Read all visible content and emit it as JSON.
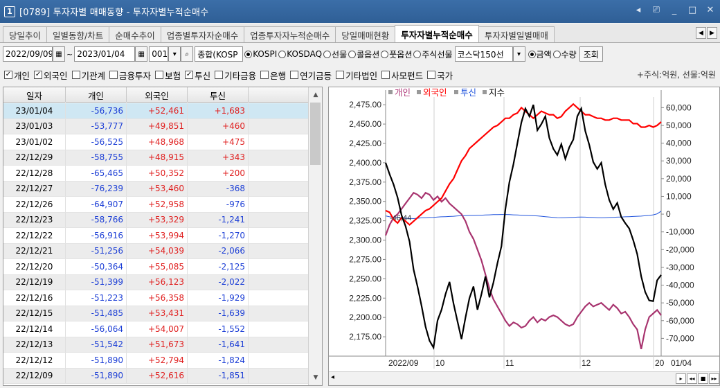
{
  "window": {
    "number": "1",
    "title": "[0789] 투자자별 매매동향 - 투자자별누적순매수",
    "controls": [
      "◂",
      "⎚",
      "_",
      "□",
      "✕"
    ]
  },
  "tabs": [
    {
      "label": "당일추이",
      "active": false
    },
    {
      "label": "일별동향/차트",
      "active": false
    },
    {
      "label": "순매수추이",
      "active": false
    },
    {
      "label": "업종별투자자순매수",
      "active": false
    },
    {
      "label": "업종투자자누적순매수",
      "active": false
    },
    {
      "label": "당일매매현황",
      "active": false
    },
    {
      "label": "투자자별누적순매수",
      "active": true
    },
    {
      "label": "투자자별일별매매",
      "active": false
    }
  ],
  "toolbar": {
    "start_date": "2022/09/09",
    "separator": "~",
    "end_date": "2023/01/04",
    "code": "001",
    "market_name": "종합(KOSP",
    "radios1": [
      {
        "label": "KOSPI",
        "on": true
      },
      {
        "label": "KOSDAQ",
        "on": false
      },
      {
        "label": "선물",
        "on": false
      },
      {
        "label": "콜옵션",
        "on": false
      },
      {
        "label": "풋옵션",
        "on": false
      },
      {
        "label": "주식선물",
        "on": false
      }
    ],
    "index_select": "코스닥150선",
    "radios2": [
      {
        "label": "금액",
        "on": true
      },
      {
        "label": "수량",
        "on": false
      }
    ],
    "query_button": "조회"
  },
  "filters": {
    "items": [
      {
        "label": "개인",
        "checked": true
      },
      {
        "label": "외국인",
        "checked": true
      },
      {
        "label": "기관계",
        "checked": false
      },
      {
        "label": "금융투자",
        "checked": false
      },
      {
        "label": "보험",
        "checked": false
      },
      {
        "label": "투신",
        "checked": true
      },
      {
        "label": "기타금융",
        "checked": false
      },
      {
        "label": "은행",
        "checked": false
      },
      {
        "label": "연기금등",
        "checked": false
      },
      {
        "label": "기타법인",
        "checked": false
      },
      {
        "label": "사모펀드",
        "checked": false
      },
      {
        "label": "국가",
        "checked": false
      }
    ],
    "unit_note": "+주식:억원, 선물:억원"
  },
  "table": {
    "headers": [
      "일자",
      "개인",
      "외국인",
      "투신"
    ],
    "rows": [
      [
        "23/01/04",
        "-56,736",
        "+52,461",
        "+1,683"
      ],
      [
        "23/01/03",
        "-53,777",
        "+49,851",
        "+460"
      ],
      [
        "23/01/02",
        "-56,525",
        "+48,968",
        "+475"
      ],
      [
        "22/12/29",
        "-58,755",
        "+48,915",
        "+343"
      ],
      [
        "22/12/28",
        "-65,465",
        "+50,352",
        "+200"
      ],
      [
        "22/12/27",
        "-76,239",
        "+53,460",
        "-368"
      ],
      [
        "22/12/26",
        "-64,907",
        "+52,958",
        "-976"
      ],
      [
        "22/12/23",
        "-58,766",
        "+53,329",
        "-1,241"
      ],
      [
        "22/12/22",
        "-56,916",
        "+53,994",
        "-1,270"
      ],
      [
        "22/12/21",
        "-51,256",
        "+54,039",
        "-2,066"
      ],
      [
        "22/12/20",
        "-50,364",
        "+55,085",
        "-2,125"
      ],
      [
        "22/12/19",
        "-51,399",
        "+56,123",
        "-2,022"
      ],
      [
        "22/12/16",
        "-51,223",
        "+56,358",
        "-1,929"
      ],
      [
        "22/12/15",
        "-51,485",
        "+53,431",
        "-1,639"
      ],
      [
        "22/12/14",
        "-56,064",
        "+54,007",
        "-1,552"
      ],
      [
        "22/12/13",
        "-51,542",
        "+51,673",
        "-1,641"
      ],
      [
        "22/12/12",
        "-51,890",
        "+52,794",
        "-1,824"
      ],
      [
        "22/12/09",
        "-51,890",
        "+52,616",
        "-1,851"
      ]
    ]
  },
  "chart_data": {
    "type": "line",
    "legend": [
      {
        "name": "개인",
        "color": "#b03a7a"
      },
      {
        "name": "외국인",
        "color": "#ff0000"
      },
      {
        "name": "투신",
        "color": "#2255dd"
      },
      {
        "name": "지수",
        "color": "#000000"
      }
    ],
    "left_axis": {
      "ticks": [
        "2,475.00",
        "2,450.00",
        "2,425.00",
        "2,400.00",
        "2,375.00",
        "2,350.00",
        "2,325.00",
        "2,300.00",
        "2,275.00",
        "2,250.00",
        "2,225.00",
        "2,200.00",
        "2,175.00"
      ],
      "ylim": [
        2150,
        2485
      ]
    },
    "right_axis": {
      "ticks": [
        "60,000",
        "50,000",
        "40,000",
        "30,000",
        "20,000",
        "10,000",
        "0",
        "-10,000",
        "-20,000",
        "-30,000",
        "-40,000",
        "-50,000",
        "-60,000",
        "-70,000"
      ],
      "ylim": [
        -80000,
        66000
      ]
    },
    "x_labels": [
      "2022/09",
      "10",
      "11",
      "12",
      "20"
    ],
    "x_end_label": "01/04",
    "zero_label": "-46,44",
    "series": [
      {
        "name": "지수",
        "axis": "left",
        "color": "#000000",
        "values": [
          2400,
          2385,
          2372,
          2355,
          2332,
          2318,
          2298,
          2262,
          2240,
          2215,
          2188,
          2170,
          2161,
          2196,
          2210,
          2230,
          2246,
          2218,
          2195,
          2172,
          2200,
          2225,
          2240,
          2210,
          2230,
          2253,
          2226,
          2245,
          2270,
          2292,
          2340,
          2375,
          2398,
          2425,
          2452,
          2470,
          2460,
          2475,
          2442,
          2450,
          2460,
          2432,
          2418,
          2410,
          2424,
          2405,
          2420,
          2430,
          2460,
          2470,
          2441,
          2423,
          2401,
          2392,
          2400,
          2372,
          2352,
          2340,
          2348,
          2330,
          2322,
          2315,
          2300,
          2282,
          2253,
          2233,
          2222,
          2221,
          2248,
          2255
        ]
      },
      {
        "name": "외국인",
        "axis": "right",
        "color": "#ff0000",
        "values": [
          2000,
          1000,
          -3000,
          -5000,
          -2000,
          -4000,
          -6000,
          -4000,
          -2000,
          0,
          2000,
          3000,
          5000,
          7000,
          9000,
          13000,
          17000,
          20000,
          25000,
          30000,
          33000,
          37000,
          39000,
          41000,
          43000,
          45000,
          47000,
          49000,
          50000,
          52000,
          54000,
          54000,
          56000,
          57000,
          60000,
          58000,
          56000,
          54000,
          56000,
          58000,
          57000,
          56000,
          56000,
          54000,
          55000,
          58000,
          60000,
          62000,
          60000,
          58000,
          56000,
          56000,
          55000,
          54000,
          54000,
          53000,
          53000,
          54000,
          54000,
          53000,
          53000,
          53000,
          51000,
          51000,
          49000,
          49000,
          50000,
          49000,
          50000,
          52000
        ]
      },
      {
        "name": "투신",
        "axis": "right",
        "color": "#2255dd",
        "values": [
          -1000,
          -1500,
          -1700,
          -1800,
          -2000,
          -2200,
          -2400,
          -2500,
          -2300,
          -2100,
          -2000,
          -1900,
          -1800,
          -1600,
          -1500,
          -1400,
          -1300,
          -1200,
          -1000,
          -900,
          -800,
          -700,
          -700,
          -600,
          -600,
          -500,
          -400,
          -300,
          -300,
          -200,
          -200,
          -300,
          -400,
          -500,
          -600,
          -700,
          -800,
          -900,
          -1000,
          -1200,
          -1400,
          -1600,
          -1800,
          -2000,
          -2100,
          -2000,
          -1900,
          -1800,
          -1700,
          -1600,
          -1700,
          -1800,
          -1900,
          -2000,
          -2100,
          -2000,
          -1900,
          -1800,
          -1700,
          -1600,
          -1500,
          -1400,
          -1300,
          -1200,
          -1100,
          -900,
          -700,
          -400,
          200,
          1683
        ]
      },
      {
        "name": "개인",
        "axis": "right",
        "color": "#a8346f",
        "values": [
          -12000,
          -6000,
          -2000,
          0,
          3000,
          6000,
          9000,
          12000,
          11000,
          9000,
          12000,
          11000,
          8000,
          10000,
          7000,
          9000,
          6000,
          4000,
          2000,
          0,
          -4000,
          -10000,
          -14000,
          -20000,
          -26000,
          -34000,
          -42000,
          -48000,
          -52000,
          -56000,
          -60000,
          -63000,
          -61000,
          -62000,
          -64000,
          -63000,
          -60000,
          -58000,
          -61000,
          -59000,
          -60000,
          -58000,
          -57000,
          -58000,
          -60000,
          -62000,
          -63000,
          -62000,
          -58000,
          -55000,
          -52000,
          -50000,
          -52000,
          -51000,
          -50000,
          -52000,
          -54000,
          -51000,
          -53000,
          -56000,
          -55000,
          -58000,
          -62000,
          -65000,
          -76000,
          -65000,
          -58000,
          -56000,
          -54000,
          -57000
        ]
      }
    ]
  },
  "chart_scroll": {
    "left": "◂",
    "buttons": [
      "▸",
      "◂◂",
      "■",
      "▸▸"
    ]
  }
}
